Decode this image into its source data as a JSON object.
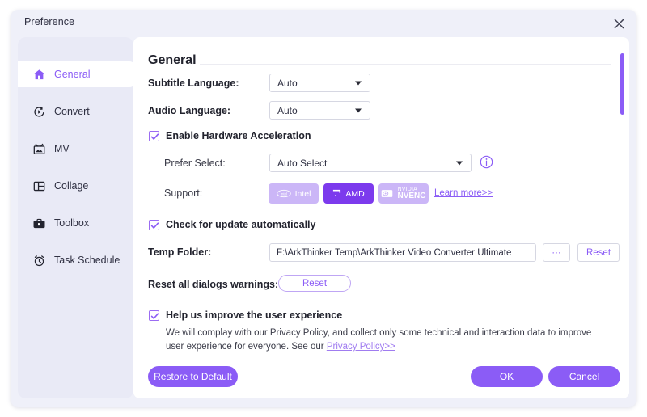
{
  "window": {
    "title": "Preference",
    "close_icon": "close-icon"
  },
  "sidebar": {
    "items": [
      {
        "label": "General",
        "icon": "home-icon",
        "active": true
      },
      {
        "label": "Convert",
        "icon": "convert-icon",
        "active": false
      },
      {
        "label": "MV",
        "icon": "mv-icon",
        "active": false
      },
      {
        "label": "Collage",
        "icon": "collage-icon",
        "active": false
      },
      {
        "label": "Toolbox",
        "icon": "toolbox-icon",
        "active": false
      },
      {
        "label": "Task Schedule",
        "icon": "alarm-icon",
        "active": false
      }
    ]
  },
  "general": {
    "heading": "General",
    "subtitle_language": {
      "label": "Subtitle Language:",
      "value": "Auto"
    },
    "audio_language": {
      "label": "Audio Language:",
      "value": "Auto"
    },
    "hardware_acceleration": {
      "label": "Enable Hardware Acceleration",
      "checked": true
    },
    "prefer_select": {
      "label": "Prefer Select:",
      "value": "Auto Select",
      "info_icon": "info-icon"
    },
    "support": {
      "label": "Support:",
      "vendors": [
        {
          "name": "Intel",
          "line1": "",
          "line2": "",
          "selected": false,
          "icon": "intel-logo-icon"
        },
        {
          "name": "AMD",
          "line1": "",
          "line2": "",
          "selected": true,
          "icon": "amd-logo-icon"
        },
        {
          "name": "",
          "line1": "NVIDIA",
          "line2": "NVENC",
          "selected": false,
          "icon": "nvidia-logo-icon"
        }
      ],
      "learn_more": "Learn more>>"
    },
    "check_update": {
      "label": "Check for update automatically",
      "checked": true
    },
    "temp_folder": {
      "label": "Temp Folder:",
      "value": "F:\\ArkThinker Temp\\ArkThinker Video Converter Ultimate",
      "browse_label": "···",
      "reset_label": "Reset"
    },
    "reset_dialogs": {
      "label": "Reset all dialogs warnings:",
      "button_label": "Reset"
    },
    "improve_experience": {
      "label": "Help us improve the user experience",
      "checked": true,
      "description_before": "We will complay with our Privacy Policy, and collect only some technical and interaction data to improve user experience for everyone. See our ",
      "link_label": "Privacy Policy>>"
    }
  },
  "footer": {
    "restore_label": "Restore to Default",
    "ok_label": "OK",
    "cancel_label": "Cancel"
  },
  "colors": {
    "accent": "#8b5cf6",
    "accent_strong": "#7c3aed",
    "badge_muted": "#cbb6f7",
    "sidebar_bg": "#e9eaf6",
    "window_bg": "#eff0f9"
  }
}
